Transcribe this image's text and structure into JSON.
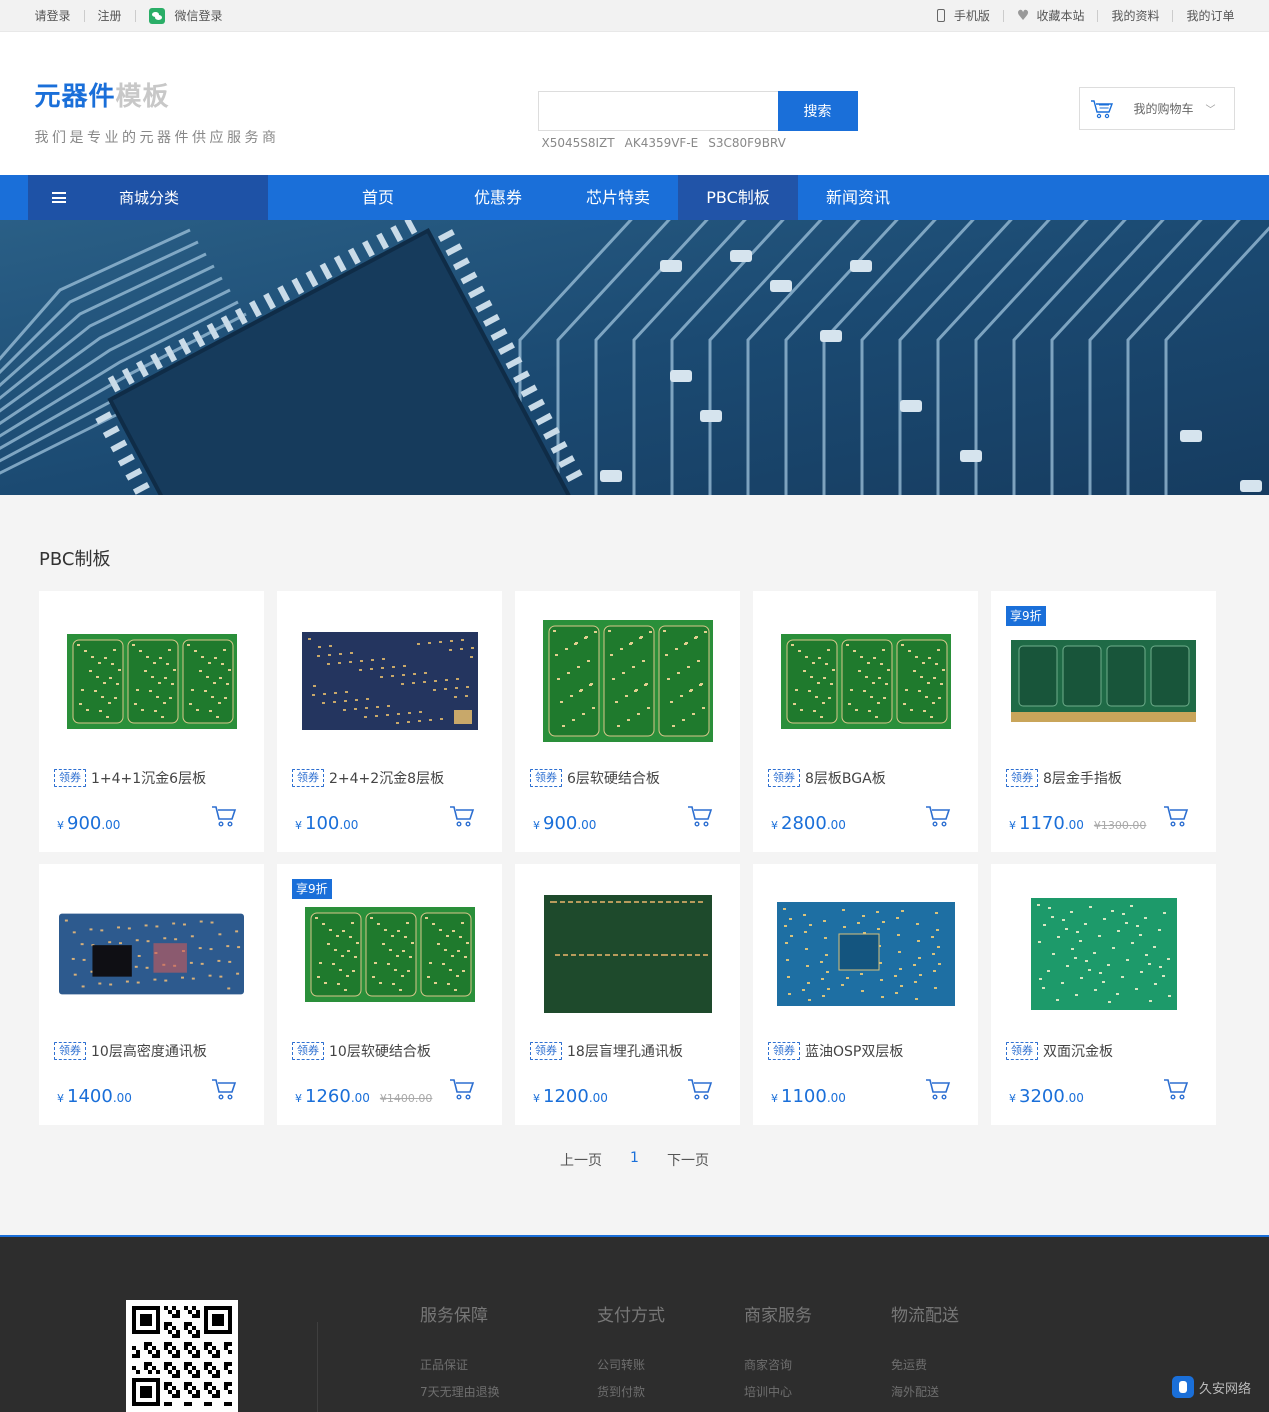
{
  "topbar": {
    "login": "请登录",
    "register": "注册",
    "wechat_login": "微信登录",
    "mobile": "手机版",
    "favorite": "收藏本站",
    "profile": "我的资料",
    "orders": "我的订单"
  },
  "header": {
    "logo_main": "元器件",
    "logo_sub": "模板",
    "slogan": "我们是专业的元器件供应服务商",
    "search_button": "搜索",
    "search_value": "",
    "hotwords": [
      "X5045S8IZT",
      "AK4359VF-E",
      "S3C80F9BRV"
    ],
    "cart_label": "我的购物车"
  },
  "nav": {
    "category": "商城分类",
    "links": [
      "首页",
      "优惠券",
      "芯片特卖",
      "PBC制板",
      "新闻资讯"
    ],
    "active_index": 3
  },
  "section_title": "PBC制板",
  "coupon_label": "领券",
  "products": [
    {
      "name": "1+4+1沉金6层板",
      "price_int": "900",
      "price_dec": ".00",
      "old_price": "",
      "badge": "",
      "board": "green3"
    },
    {
      "name": "2+4+2沉金8层板",
      "price_int": "100",
      "price_dec": ".00",
      "old_price": "",
      "badge": "",
      "board": "navy"
    },
    {
      "name": "6层软硬结合板",
      "price_int": "900",
      "price_dec": ".00",
      "old_price": "",
      "badge": "",
      "board": "green3tall"
    },
    {
      "name": "8层板BGA板",
      "price_int": "2800",
      "price_dec": ".00",
      "old_price": "",
      "badge": "",
      "board": "green3"
    },
    {
      "name": "8层金手指板",
      "price_int": "1170",
      "price_dec": ".00",
      "old_price": "¥1300.00",
      "badge": "享9折",
      "board": "dimm"
    },
    {
      "name": "10层高密度通讯板",
      "price_int": "1400",
      "price_dec": ".00",
      "old_price": "",
      "badge": "",
      "board": "bluechip"
    },
    {
      "name": "10层软硬结合板",
      "price_int": "1260",
      "price_dec": ".00",
      "old_price": "¥1400.00",
      "badge": "享9折",
      "board": "green3"
    },
    {
      "name": "18层盲埋孔通讯板",
      "price_int": "1200",
      "price_dec": ".00",
      "old_price": "",
      "badge": "",
      "board": "darkgreen"
    },
    {
      "name": "蓝油OSP双层板",
      "price_int": "1100",
      "price_dec": ".00",
      "old_price": "",
      "badge": "",
      "board": "blue"
    },
    {
      "name": "双面沉金板",
      "price_int": "3200",
      "price_dec": ".00",
      "old_price": "",
      "badge": "",
      "board": "lightgreen"
    }
  ],
  "currency": "¥",
  "pager": {
    "prev": "上一页",
    "current": "1",
    "next": "下一页"
  },
  "footer": {
    "columns": [
      {
        "title": "服务保障",
        "items": [
          "正品保证",
          "7天无理由退换"
        ]
      },
      {
        "title": "支付方式",
        "items": [
          "公司转账",
          "货到付款"
        ]
      },
      {
        "title": "商家服务",
        "items": [
          "商家咨询",
          "培训中心"
        ]
      },
      {
        "title": "物流配送",
        "items": [
          "免运费",
          "海外配送"
        ]
      }
    ],
    "watermark": "久安网络"
  },
  "colors": {
    "brand": "#1a6fd9",
    "nav_dark": "#1e52a6",
    "footer_bg": "#2d2d2d"
  }
}
